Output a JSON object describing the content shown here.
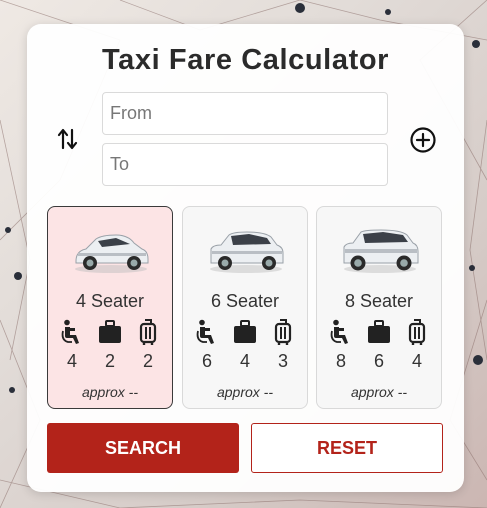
{
  "title": "Taxi Fare Calculator",
  "from": {
    "placeholder": "From",
    "value": ""
  },
  "to": {
    "placeholder": "To",
    "value": ""
  },
  "icons": {
    "swap": "swap-vertical-arrows-icon",
    "add": "add-circle-icon",
    "passengers": "seated-person-icon",
    "luggage": "suitcase-icon",
    "bags": "trolley-bag-icon"
  },
  "vehicles": [
    {
      "label": "4 Seater",
      "selected": true,
      "passengers": "4",
      "luggage": "2",
      "bags": "2",
      "fare": "approx --",
      "image": "white-sedan"
    },
    {
      "label": "6 Seater",
      "selected": false,
      "passengers": "6",
      "luggage": "4",
      "bags": "3",
      "fare": "approx --",
      "image": "white-suv"
    },
    {
      "label": "8 Seater",
      "selected": false,
      "passengers": "8",
      "luggage": "6",
      "bags": "4",
      "fare": "approx --",
      "image": "white-large-suv"
    }
  ],
  "buttons": {
    "search": "SEARCH",
    "reset": "RESET"
  },
  "colors": {
    "primary": "#b3231a",
    "selected_card": "#fce4e5",
    "text": "#2b2b2b"
  }
}
